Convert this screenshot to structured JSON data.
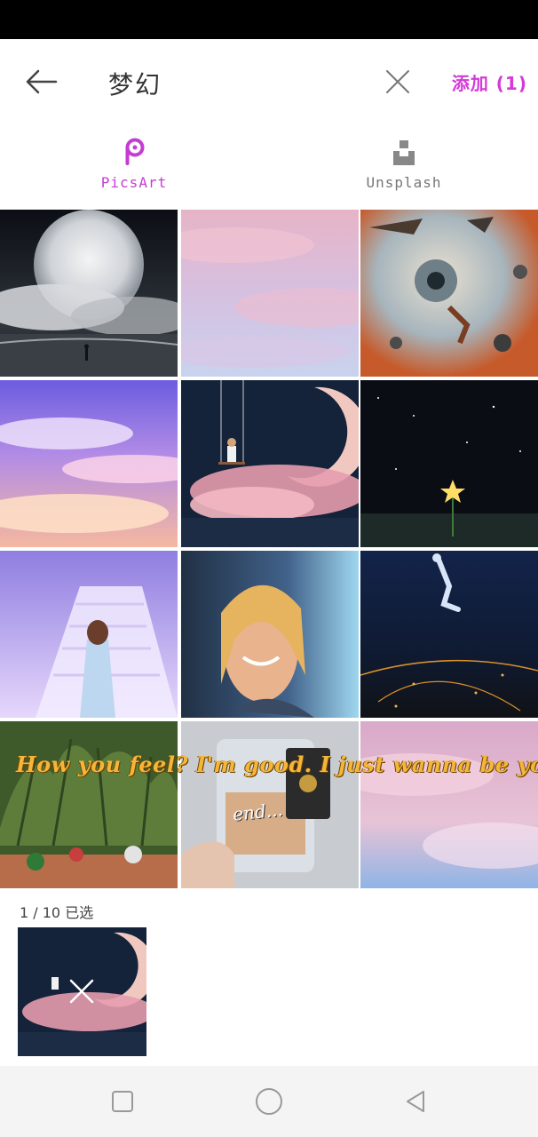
{
  "header": {
    "title": "梦幻",
    "add_label": "添加 (1)",
    "icons": {
      "back": "arrow-left-icon",
      "close": "close-icon"
    }
  },
  "source_tabs": [
    {
      "label": "PicsArt",
      "icon": "picsart-logo-icon",
      "active": true,
      "color": "#c53cd3"
    },
    {
      "label": "Unsplash",
      "icon": "unsplash-logo-icon",
      "active": false,
      "color": "#777777"
    }
  ],
  "grid": {
    "items": [
      {
        "id": "moon-sea",
        "selected": false
      },
      {
        "id": "pink-clouds",
        "selected": false
      },
      {
        "id": "floating-rocks-eye",
        "selected": false
      },
      {
        "id": "purple-sky-clouds",
        "selected": false
      },
      {
        "id": "moon-swing-girl",
        "selected": true
      },
      {
        "id": "starry-night-flower",
        "selected": false
      },
      {
        "id": "stairs-girl",
        "selected": false
      },
      {
        "id": "smiling-woman",
        "selected": false
      },
      {
        "id": "falling-man-city",
        "selected": false
      },
      {
        "id": "garden-gnomes",
        "selected": false
      },
      {
        "id": "money-jar",
        "selected": false
      },
      {
        "id": "pastel-sky",
        "selected": false
      }
    ],
    "overlay_caption": "How you feel? I'm good. I just wanna be you",
    "jar_label": "end..."
  },
  "selection": {
    "count_text": "1 / 10 已选",
    "remove_icon": "close-icon"
  },
  "nav": {
    "icons": [
      "square-recents-icon",
      "circle-home-icon",
      "triangle-back-icon"
    ]
  },
  "colors": {
    "accent": "#d43ad8",
    "status_bar": "#000000",
    "nav_bar": "#f4f4f4"
  }
}
